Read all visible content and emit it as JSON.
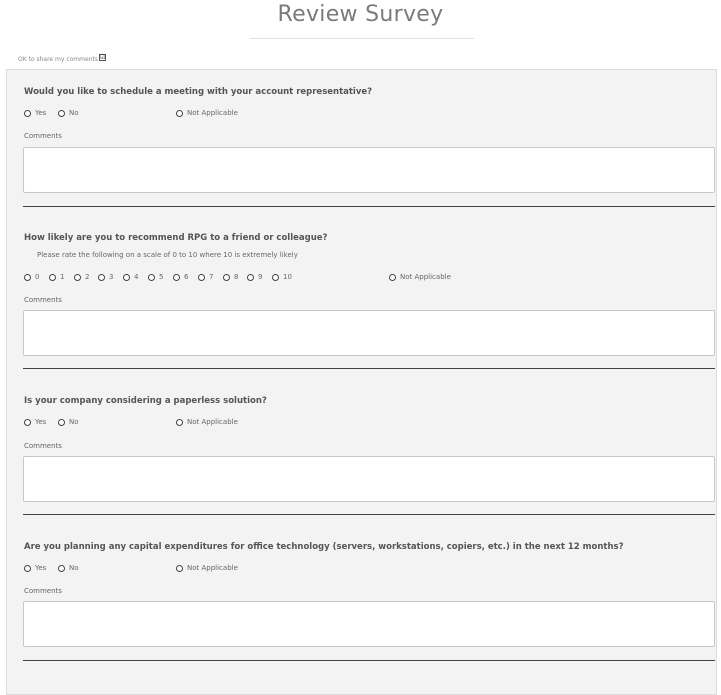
{
  "page": {
    "title": "Review Survey"
  },
  "share": {
    "label": "OK to share my comments",
    "checked": true,
    "check_glyph": "☑"
  },
  "comments_label": "Comments",
  "questions": [
    {
      "question": "Would you like to schedule a meeting with your account representative?",
      "options": [
        "Yes",
        "No"
      ],
      "na_label": "Not Applicable"
    },
    {
      "question": "How likely are you to recommend RPG to a friend or colleague?",
      "subtext": "Please rate the following on a scale of 0 to 10 where 10 is extremely likely",
      "options": [
        "0",
        "1",
        "2",
        "3",
        "4",
        "5",
        "6",
        "7",
        "8",
        "9",
        "10"
      ],
      "na_label": "Not Applicable"
    },
    {
      "question": "Is your company considering a paperless solution?",
      "options": [
        "Yes",
        "No"
      ],
      "na_label": "Not Applicable"
    },
    {
      "question": "Are you planning any capital expenditures for office technology (servers, workstations, copiers, etc.) in the next 12 months?",
      "options": [
        "Yes",
        "No"
      ],
      "na_label": "Not Applicable"
    }
  ]
}
